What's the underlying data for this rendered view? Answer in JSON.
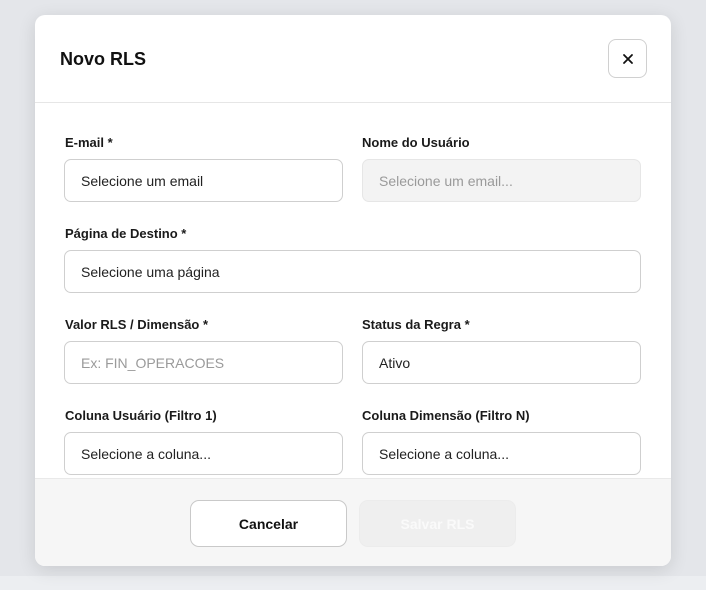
{
  "modal": {
    "title": "Novo RLS",
    "close_icon": "close-icon"
  },
  "form": {
    "email": {
      "label": "E-mail *",
      "value": "Selecione um email"
    },
    "user_name": {
      "label": "Nome do Usuário",
      "placeholder": "Selecione um email..."
    },
    "destination_page": {
      "label": "Página de Destino *",
      "value": "Selecione uma página"
    },
    "rls_value": {
      "label": "Valor RLS / Dimensão *",
      "placeholder": "Ex: FIN_OPERACOES"
    },
    "rule_status": {
      "label": "Status da Regra *",
      "value": "Ativo"
    },
    "user_column": {
      "label": "Coluna Usuário (Filtro 1)",
      "value": "Selecione a coluna..."
    },
    "dimension_column": {
      "label": "Coluna Dimensão (Filtro N)",
      "value": "Selecione a coluna..."
    }
  },
  "footer": {
    "cancel_label": "Cancelar",
    "save_label": "Salvar RLS"
  }
}
